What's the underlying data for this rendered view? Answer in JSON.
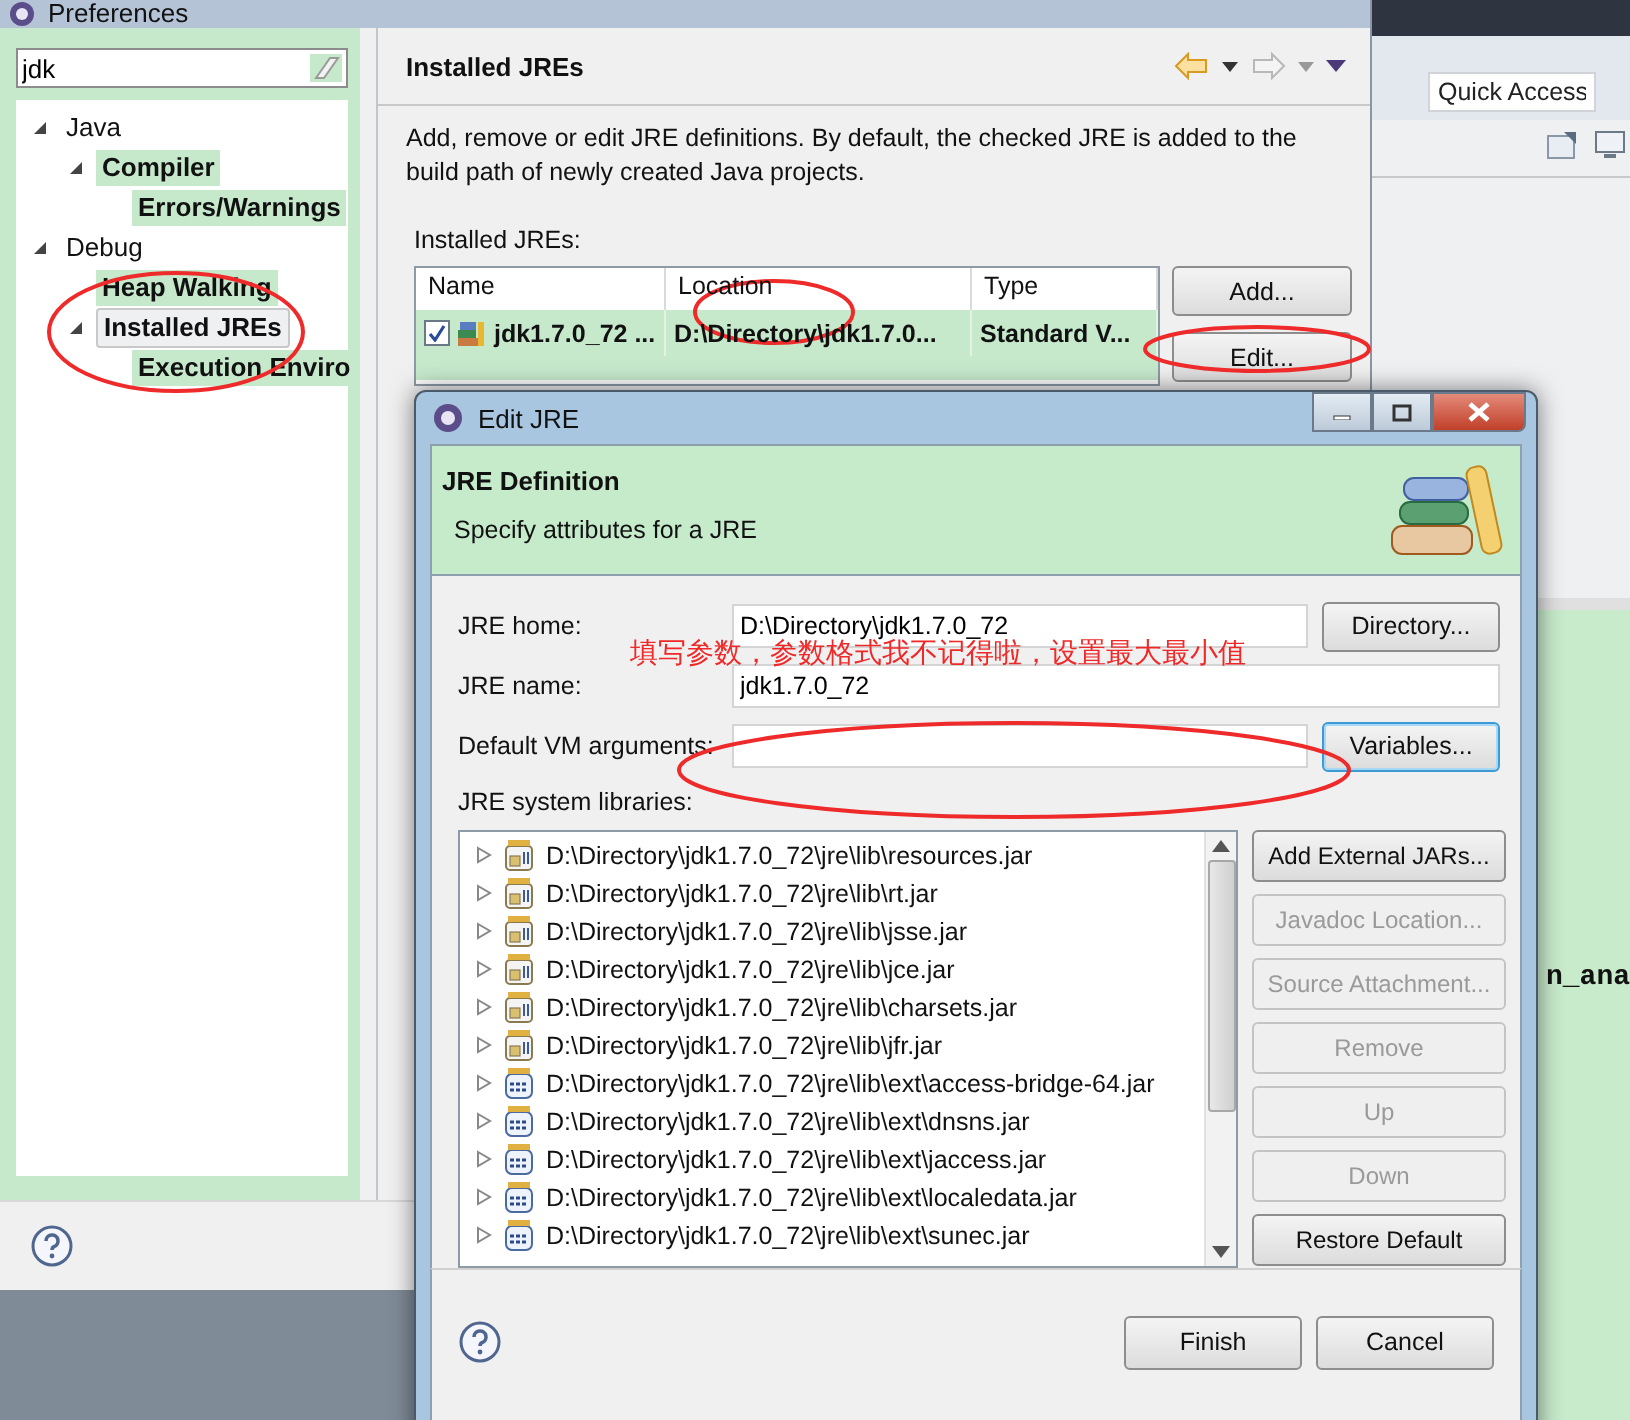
{
  "preferences": {
    "title": "Preferences",
    "filter": {
      "value": "jdk"
    },
    "tree": [
      {
        "label": "Java",
        "match": false,
        "selected": false,
        "expanded": true,
        "children": [
          {
            "label": "Compiler",
            "match": true,
            "selected": false,
            "expanded": true,
            "children": [
              {
                "label": "Errors/Warnings",
                "match": true,
                "selected": false
              }
            ]
          }
        ]
      },
      {
        "label": "Debug",
        "match": false,
        "selected": false,
        "expanded": true,
        "children": [
          {
            "label": "Heap Walking",
            "match": true,
            "selected": false
          },
          {
            "label": "Installed JREs",
            "match": true,
            "selected": true,
            "expanded": true,
            "children": [
              {
                "label": "Execution Enviro",
                "match": true,
                "selected": false
              }
            ]
          }
        ]
      }
    ],
    "page": {
      "title": "Installed JREs",
      "description": "Add, remove or edit JRE definitions. By default, the checked JRE is added to the build path of newly created Java projects.",
      "list_label": "Installed JREs:",
      "table": {
        "columns": [
          "Name",
          "Location",
          "Type"
        ],
        "rows": [
          {
            "checked": true,
            "cells": [
              "jdk1.7.0_72 ...",
              "D:\\Directory\\jdk1.7.0...",
              "Standard V..."
            ]
          }
        ]
      },
      "buttons": [
        "Add...",
        "Edit..."
      ]
    }
  },
  "workbench": {
    "quick_access": {
      "placeholder": "Quick Access"
    },
    "editor_text": "n_ana"
  },
  "dialog": {
    "title": "Edit JRE",
    "header": {
      "title": "JRE Definition",
      "subtitle": "Specify attributes for a JRE"
    },
    "fields": [
      {
        "label": "JRE home:",
        "value": "D:\\Directory\\jdk1.7.0_72",
        "button": "Directory...",
        "focused": false
      },
      {
        "label": "JRE name:",
        "value": "jdk1.7.0_72"
      },
      {
        "label": "Default VM arguments:",
        "button": "Variables...",
        "focused": true
      }
    ],
    "libraries_label": "JRE system libraries:",
    "libraries": [
      {
        "kind": "jar",
        "path": "D:\\Directory\\jdk1.7.0_72\\jre\\lib\\resources.jar"
      },
      {
        "kind": "jar",
        "path": "D:\\Directory\\jdk1.7.0_72\\jre\\lib\\rt.jar"
      },
      {
        "kind": "jar",
        "path": "D:\\Directory\\jdk1.7.0_72\\jre\\lib\\jsse.jar"
      },
      {
        "kind": "jar",
        "path": "D:\\Directory\\jdk1.7.0_72\\jre\\lib\\jce.jar"
      },
      {
        "kind": "jar",
        "path": "D:\\Directory\\jdk1.7.0_72\\jre\\lib\\charsets.jar"
      },
      {
        "kind": "jar",
        "path": "D:\\Directory\\jdk1.7.0_72\\jre\\lib\\jfr.jar"
      },
      {
        "kind": "ext",
        "path": "D:\\Directory\\jdk1.7.0_72\\jre\\lib\\ext\\access-bridge-64.jar"
      },
      {
        "kind": "ext",
        "path": "D:\\Directory\\jdk1.7.0_72\\jre\\lib\\ext\\dnsns.jar"
      },
      {
        "kind": "ext",
        "path": "D:\\Directory\\jdk1.7.0_72\\jre\\lib\\ext\\jaccess.jar"
      },
      {
        "kind": "ext",
        "path": "D:\\Directory\\jdk1.7.0_72\\jre\\lib\\ext\\localedata.jar"
      },
      {
        "kind": "ext",
        "path": "D:\\Directory\\jdk1.7.0_72\\jre\\lib\\ext\\sunec.jar"
      }
    ],
    "library_buttons": [
      {
        "label": "Add External JARs...",
        "disabled": false
      },
      {
        "label": "Javadoc Location...",
        "disabled": true
      },
      {
        "label": "Source Attachment...",
        "disabled": true
      },
      {
        "label": "Remove",
        "disabled": true
      },
      {
        "label": "Up",
        "disabled": true
      },
      {
        "label": "Down",
        "disabled": true
      },
      {
        "label": "Restore Default",
        "disabled": false
      }
    ],
    "buttons": [
      "Finish",
      "Cancel"
    ]
  },
  "annotation": {
    "note": "填写参数，参数格式我不记得啦，设置最大最小值"
  }
}
